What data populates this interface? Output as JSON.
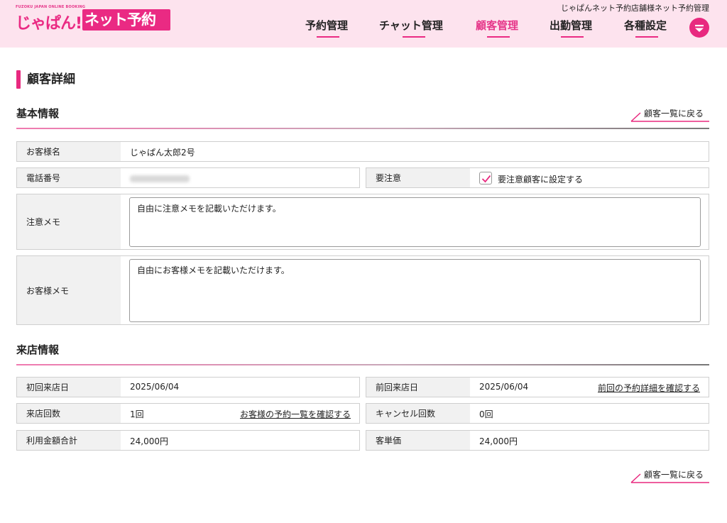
{
  "header": {
    "logo_sub": "FUZOKU JAPAN ONLINE BOOKING",
    "logo_left": "じゃぱん!",
    "logo_right": "ネット予約",
    "subtitle": "じゃぱんネット予約店舗様ネット予約管理",
    "nav": [
      {
        "label": "予約管理",
        "active": false
      },
      {
        "label": "チャット管理",
        "active": false
      },
      {
        "label": "顧客管理",
        "active": true
      },
      {
        "label": "出勤管理",
        "active": false
      },
      {
        "label": "各種設定",
        "active": false
      }
    ],
    "menu_icon": "chevron-down-icon",
    "accent_color": "#e8297f",
    "header_bg": "#fde3ee"
  },
  "page": {
    "title": "顧客詳細"
  },
  "basic": {
    "title": "基本情報",
    "back_link": "顧客一覧に戻る",
    "name_label": "お客様名",
    "name_value": "じゃぱん太郎2号",
    "phone_label": "電話番号",
    "caution_label": "要注意",
    "caution_checkbox_label": "要注意顧客に設定する",
    "caution_checked": true,
    "caution_memo_label": "注意メモ",
    "caution_memo_value": "自由に注意メモを記載いただけます。",
    "customer_memo_label": "お客様メモ",
    "customer_memo_value": "自由にお客様メモを記載いただけます。"
  },
  "visit": {
    "title": "来店情報",
    "first_visit_label": "初回来店日",
    "first_visit_value": "2025/06/04",
    "last_visit_label": "前回来店日",
    "last_visit_value": "2025/06/04",
    "last_visit_link": "前回の予約詳細を確認する",
    "visit_count_label": "来店回数",
    "visit_count_value": "1回",
    "visit_count_link": "お客様の予約一覧を確認する",
    "cancel_count_label": "キャンセル回数",
    "cancel_count_value": "0回",
    "total_label": "利用金額合計",
    "total_value": "24,000円",
    "unit_price_label": "客単価",
    "unit_price_value": "24,000円"
  },
  "footer": {
    "back_link": "顧客一覧に戻る"
  }
}
